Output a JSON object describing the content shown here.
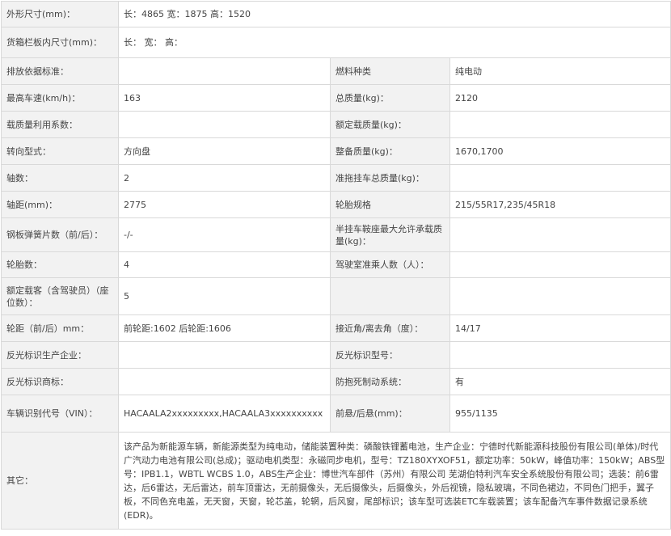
{
  "rows": [
    {
      "l1": "外形尺寸(mm)：",
      "v1": "长：4865 宽：1875 高：1520"
    },
    {
      "l1": "货箱栏板内尺寸(mm)：",
      "v1": "长： 宽： 高："
    },
    {
      "l1": "排放依据标准：",
      "v1": "",
      "l2": "燃料种类",
      "v2": "纯电动"
    },
    {
      "l1": "最高车速(km/h)：",
      "v1": "163",
      "l2": "总质量(kg)：",
      "v2": "2120"
    },
    {
      "l1": "载质量利用系数：",
      "v1": "",
      "l2": "额定载质量(kg)：",
      "v2": ""
    },
    {
      "l1": "转向型式：",
      "v1": "方向盘",
      "l2": "整备质量(kg)：",
      "v2": "1670,1700"
    },
    {
      "l1": "轴数：",
      "v1": "2",
      "l2": "准拖挂车总质量(kg)：",
      "v2": ""
    },
    {
      "l1": "轴距(mm)：",
      "v1": "2775",
      "l2": "轮胎规格",
      "v2": "215/55R17,235/45R18"
    },
    {
      "l1": "钢板弹簧片数（前/后）：",
      "v1": "-/-",
      "l2": "半挂车鞍座最大允许承载质量(kg)：",
      "v2": ""
    },
    {
      "l1": "轮胎数：",
      "v1": "4",
      "l2": "驾驶室准乘人数（人）：",
      "v2": ""
    },
    {
      "l1": "额定载客（含驾驶员）（座位数）：",
      "v1": "5"
    },
    {
      "l1": "轮距（前/后）mm：",
      "v1": "前轮距:1602 后轮距:1606",
      "l2": "接近角/离去角（度）：",
      "v2": "14/17"
    },
    {
      "l1": "反光标识生产企业：",
      "v1": "",
      "l2": "反光标识型号：",
      "v2": ""
    },
    {
      "l1": "反光标识商标：",
      "v1": "",
      "l2": "防抱死制动系统：",
      "v2": "有"
    },
    {
      "l1": "车辆识别代号（VIN）：",
      "v1": "HACAALA2xxxxxxxxx,HACAALA3xxxxxxxxxx",
      "l2": "前悬/后悬(mm)：",
      "v2": "955/1135"
    },
    {
      "l1": "其它：",
      "v1": "该产品为新能源车辆，新能源类型为纯电动，储能装置种类：磷酸铁锂蓄电池，生产企业：宁德时代新能源科技股份有限公司(单体)/时代广汽动力电池有限公司(总成)；驱动电机类型：永磁同步电机，型号：TZ180XYXOF51，额定功率：50kW，峰值功率：150kW；ABS型号：IPB1.1，WBTL WCBS 1.0，ABS生产企业：博世汽车部件（苏州）有限公司 芜湖伯特利汽车安全系统股份有限公司；选装：前6雷达，后6雷达，无后雷达，前车顶雷达，无前摄像头，无后摄像头，后摄像头，外后视镜，隐私玻璃，不同色裙边，不同色门把手，翼子板，不同色充电盖，无天窗，天窗，轮芯盖，轮辋，后风窗，尾部标识；该车型可选装ETC车载装置；该车配备汽车事件数据记录系统(EDR)。"
    }
  ]
}
